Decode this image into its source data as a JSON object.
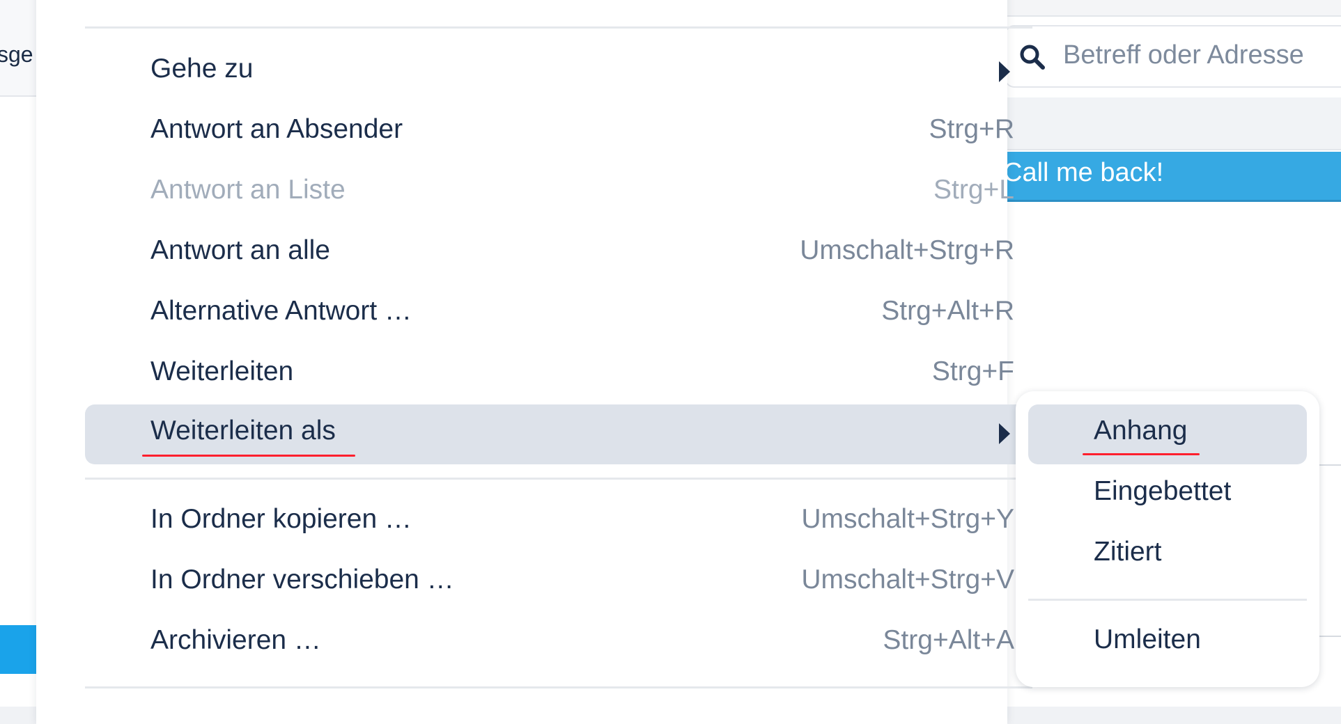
{
  "background": {
    "left_tab_text": "sge",
    "search": {
      "placeholder": "Betreff oder Adresse"
    },
    "selected_message": "Call me back!"
  },
  "context_menu": {
    "items": [
      {
        "label": "Gehe zu",
        "shortcut": "",
        "submenu": true,
        "disabled": false
      },
      {
        "label": "Antwort an Absender",
        "shortcut": "Strg+R",
        "disabled": false
      },
      {
        "label": "Antwort an Liste",
        "shortcut": "Strg+L",
        "disabled": true
      },
      {
        "label": "Antwort an alle",
        "shortcut": "Umschalt+Strg+R",
        "disabled": false
      },
      {
        "label": "Alternative Antwort …",
        "shortcut": "Strg+Alt+R",
        "disabled": false
      },
      {
        "label": "Weiterleiten",
        "shortcut": "Strg+F",
        "disabled": false
      },
      {
        "label": "Weiterleiten als",
        "shortcut": "",
        "submenu": true,
        "highlighted": true,
        "disabled": false
      },
      {
        "label": "In Ordner kopieren …",
        "shortcut": "Umschalt+Strg+Y",
        "disabled": false
      },
      {
        "label": "In Ordner verschieben …",
        "shortcut": "Umschalt+Strg+V",
        "disabled": false
      },
      {
        "label": "Archivieren …",
        "shortcut": "Strg+Alt+A",
        "disabled": false
      }
    ]
  },
  "forward_as_submenu": {
    "items": [
      {
        "label": "Anhang",
        "highlighted": true
      },
      {
        "label": "Eingebettet"
      },
      {
        "label": "Zitiert"
      },
      {
        "label": "Umleiten"
      }
    ]
  },
  "colors": {
    "text": "#1b2d4a",
    "shortcut": "#7a8799",
    "disabled": "#a1acba",
    "hover": "#dde2ea",
    "annotation_underline": "#ff1f2d",
    "selected_message": "#36a9e3"
  }
}
